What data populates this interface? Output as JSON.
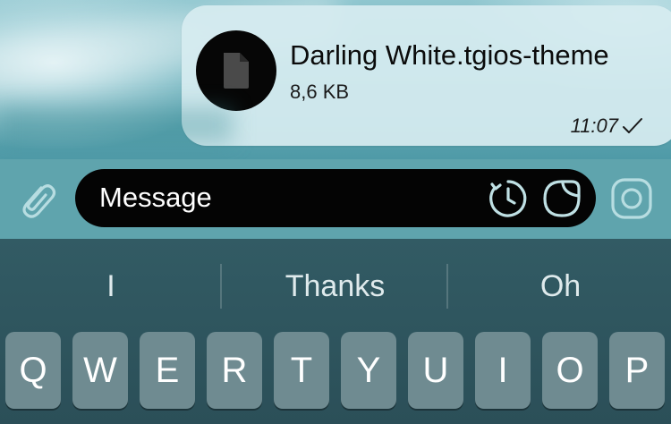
{
  "message": {
    "file_name": "Darling White.tgios-theme",
    "file_size": "8,6 KB",
    "time": "11:07",
    "status_icon": "check-icon"
  },
  "input": {
    "placeholder": "Message",
    "attach_icon": "paperclip-icon",
    "timer_icon": "timer-icon",
    "sticker_icon": "sticker-icon",
    "camera_icon": "camera-icon"
  },
  "keyboard": {
    "suggestions": [
      "I",
      "Thanks",
      "Oh"
    ],
    "keys": [
      "Q",
      "W",
      "E",
      "R",
      "T",
      "Y",
      "U",
      "I",
      "O",
      "P"
    ]
  },
  "colors": {
    "bubble": "#d6ecf0",
    "input_bar": "#5fa4ad",
    "field": "#040404",
    "accent_icon": "#bfe0e4",
    "keyboard": "#2f5560",
    "key": "#6f8b91"
  }
}
